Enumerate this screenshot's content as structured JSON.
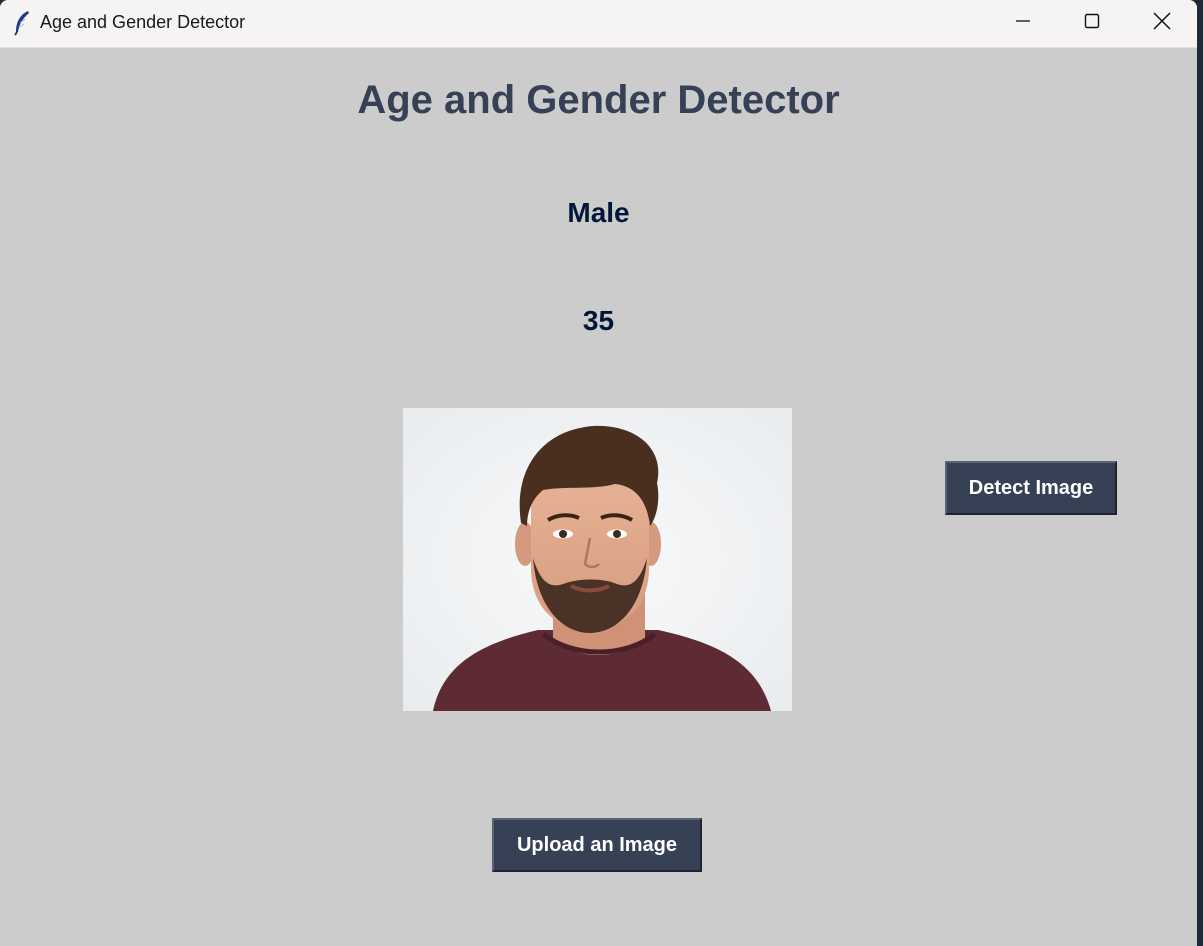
{
  "window": {
    "title": "Age and Gender Detector",
    "icons": {
      "app": "feather-icon",
      "minimize": "minimize-icon",
      "maximize": "maximize-icon",
      "close": "close-icon"
    }
  },
  "main": {
    "heading": "Age and Gender Detector",
    "gender_result": "Male",
    "age_result": "35",
    "photo": "uploaded-face-photo"
  },
  "buttons": {
    "detect_label": "Detect Image",
    "upload_label": "Upload an Image"
  },
  "colors": {
    "background": "#cccccc",
    "heading": "#364156",
    "result_text": "#011638",
    "button_bg": "#364156",
    "button_fg": "#ffffff"
  }
}
